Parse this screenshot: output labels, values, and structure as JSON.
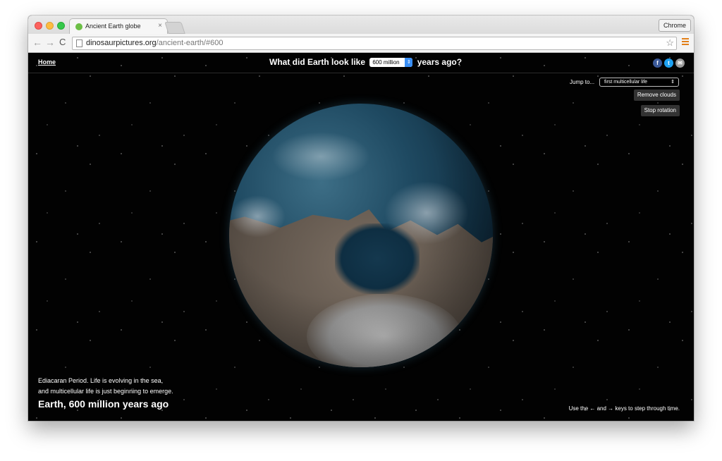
{
  "browser": {
    "tab_title": "Ancient Earth globe",
    "tab_close": "×",
    "profile_label": "Chrome",
    "url_host": "dinosaurpictures.org",
    "url_path": "/ancient-earth/#600",
    "nav_back": "←",
    "nav_forward": "→",
    "nav_reload": "C",
    "bookmark_star": "☆"
  },
  "page": {
    "home_link": "Home",
    "headline_before": "What did Earth look like",
    "age_value": "600 million",
    "headline_after": "years ago?",
    "social": {
      "facebook": "f",
      "twitter": "t",
      "email": "✉"
    },
    "jump_label": "Jump to...",
    "jump_value": "first multicellular life",
    "remove_clouds_button": "Remove clouds",
    "stop_rotation_button": "Stop rotation",
    "period_line1": "Ediacaran Period. Life is evolving in the sea,",
    "period_line2": "and multicellular life is just beginning to emerge.",
    "caption": "Earth, 600 million years ago",
    "keys_hint": "Use the ← and → keys to step through time."
  }
}
